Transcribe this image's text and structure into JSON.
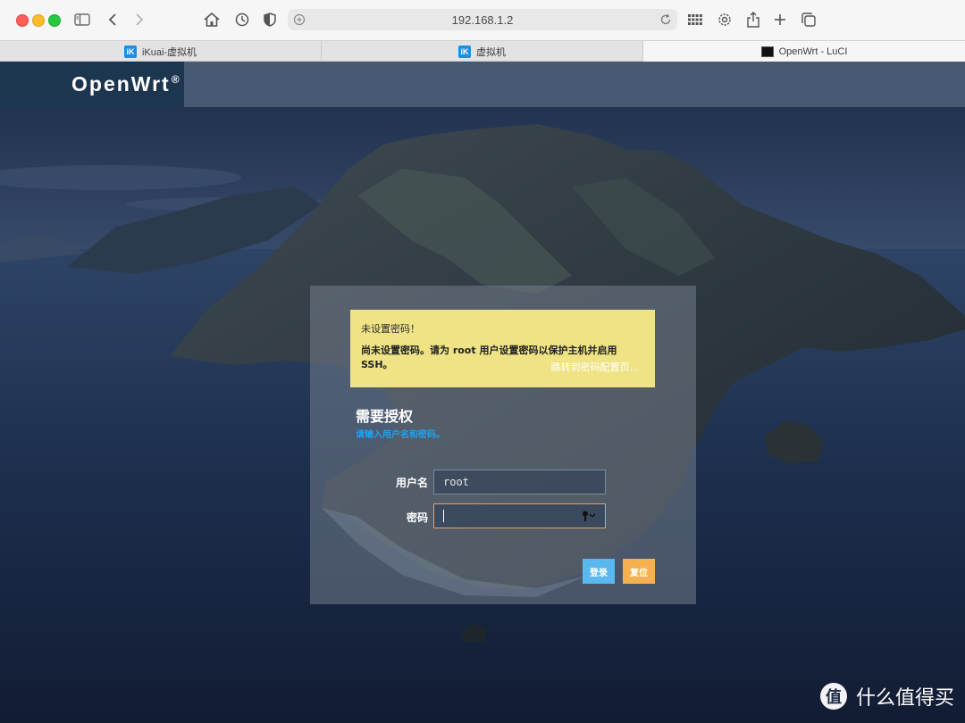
{
  "browser": {
    "address": "192.168.1.2",
    "tabs": [
      {
        "label": "iKuai-虚拟机",
        "favicon": "ikuai-icon",
        "active": false
      },
      {
        "label": "虚拟机",
        "favicon": "ikuai-icon",
        "active": false
      },
      {
        "label": "OpenWrt - LuCI",
        "favicon": "openwrt-icon",
        "active": true
      }
    ],
    "colors": {
      "close": "#fe5f57",
      "minimize": "#febc2e",
      "zoom": "#28c840"
    }
  },
  "header": {
    "brand": "OpenWrt",
    "brand_mark": "®"
  },
  "alert": {
    "title": "未设置密码！",
    "body": "尚未设置密码。请为 root 用户设置密码以保护主机并启用 SSH。",
    "link": "跳转到密码配置页..."
  },
  "login": {
    "title": "需要授权",
    "hint": "请输入用户名和密码。",
    "username_label": "用户名",
    "username_value": "root",
    "password_label": "密码",
    "password_value": "",
    "login_button": "登录",
    "reset_button": "复位"
  },
  "watermark": {
    "logo": "值",
    "text": "什么值得买"
  },
  "colors": {
    "alert_bg": "#efe385",
    "hint": "#1fa2f3",
    "login_button": "#59b8ee",
    "reset_button": "#f6b14f"
  }
}
